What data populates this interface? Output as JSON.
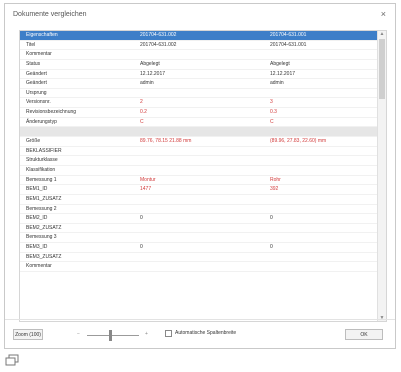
{
  "dialog": {
    "title": "Dokumente vergleichen",
    "close_glyph": "×"
  },
  "grid": {
    "header": [
      "Eigenschaften",
      "201704-631.002",
      "201704-631.001"
    ],
    "rows": [
      {
        "cells": [
          "Titel",
          "201704-631.002",
          "201704-631.001"
        ],
        "diff": false
      },
      {
        "cells": [
          "Kommentar",
          "",
          ""
        ],
        "diff": false
      },
      {
        "cells": [
          "Status",
          "Abgelegt",
          "Abgelegt"
        ],
        "diff": false
      },
      {
        "cells": [
          "Geändert",
          "12.12.2017",
          "12.12.2017"
        ],
        "diff": false
      },
      {
        "cells": [
          "Geändert",
          "admin",
          "admin"
        ],
        "diff": false
      },
      {
        "cells": [
          "Ursprung",
          "",
          ""
        ],
        "diff": false
      },
      {
        "cells": [
          "Versionsnr.",
          "2",
          "3"
        ],
        "diff": true
      },
      {
        "cells": [
          "Revisionsbezeichnung",
          "0.2",
          "0.3"
        ],
        "diff": true
      },
      {
        "cells": [
          "Änderungstyp",
          "C",
          "C"
        ],
        "diff": true
      },
      {
        "cells": [
          "",
          "",
          ""
        ],
        "sep": true
      },
      {
        "cells": [
          "Größe",
          "89.76, 78.15 21.88 mm",
          "(89.96, 27.83, 22.60) mm"
        ],
        "diff": true
      },
      {
        "cells": [
          "BEKLASSIFIER",
          "",
          ""
        ],
        "diff": false
      },
      {
        "cells": [
          "Strukturklasse",
          "",
          ""
        ],
        "diff": false
      },
      {
        "cells": [
          "Klassifikation",
          "",
          ""
        ],
        "diff": false
      },
      {
        "cells": [
          "Bemessung 1",
          "Montur",
          "Rohr"
        ],
        "diff": true
      },
      {
        "cells": [
          "BEM1_ID",
          "1477",
          "392"
        ],
        "diff": true
      },
      {
        "cells": [
          "BEM1_ZUSATZ",
          "",
          ""
        ],
        "diff": false
      },
      {
        "cells": [
          "Bemessung 2",
          "",
          ""
        ],
        "diff": false
      },
      {
        "cells": [
          "BEM2_ID",
          "0",
          "0"
        ],
        "diff": false
      },
      {
        "cells": [
          "BEM2_ZUSATZ",
          "",
          ""
        ],
        "diff": false
      },
      {
        "cells": [
          "Bemessung 3",
          "",
          ""
        ],
        "diff": false
      },
      {
        "cells": [
          "BEM3_ID",
          "0",
          "0"
        ],
        "diff": false
      },
      {
        "cells": [
          "BEM3_ZUSATZ",
          "",
          ""
        ],
        "diff": false
      },
      {
        "cells": [
          "Kommentar",
          "",
          ""
        ],
        "diff": false
      }
    ],
    "diff_color": "#d23b3b",
    "header_color": "#3d7ec8"
  },
  "footer": {
    "zoom_label": "Zoom (100)",
    "slider_minus": "−",
    "slider_plus": "+",
    "checkbox_label": "Automatische Spaltenbreite",
    "checkbox_checked": false,
    "ok_label": "OK"
  },
  "taskbar": {
    "restore_icon": "restore-window-icon"
  }
}
